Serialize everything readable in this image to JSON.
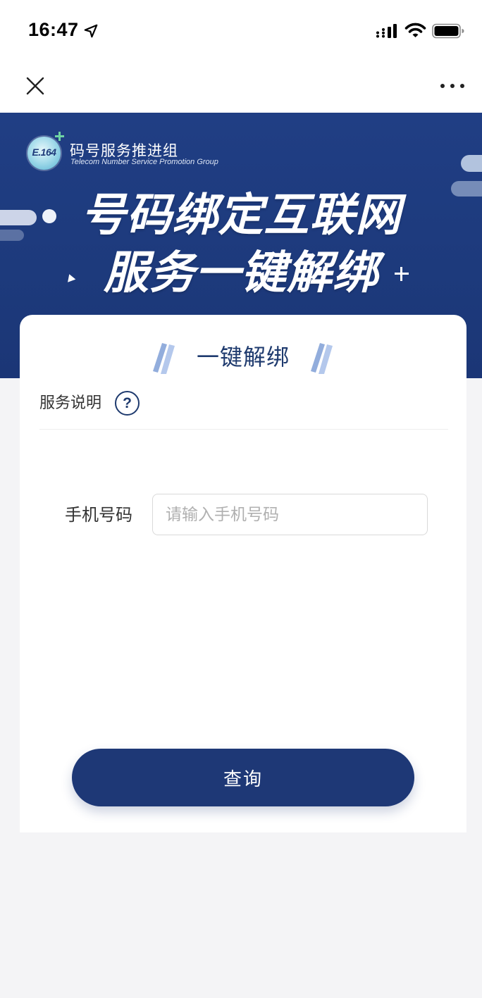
{
  "status_bar": {
    "time": "16:47",
    "icons": [
      "location-arrow-icon",
      "signal-icon",
      "wifi-icon",
      "battery-icon"
    ]
  },
  "nav_bar": {
    "icons": [
      "close-icon",
      "more-icon"
    ]
  },
  "banner": {
    "logo_text": "E.164",
    "org_name": "码号服务推进组",
    "org_name_en": "Telecom Number Service Promotion Group",
    "headline": {
      "line1": "号码绑定互联网",
      "line2": "服务一键解绑"
    }
  },
  "card": {
    "title": "一键解绑",
    "service_note": {
      "label": "服务说明",
      "help_glyph": "?"
    },
    "phone": {
      "label": "手机号码",
      "value": "",
      "placeholder": "请输入手机号码"
    },
    "submit_label": "查询"
  },
  "colors": {
    "brand_navy": "#1e3a7a",
    "button_navy": "#1e3876",
    "title_text": "#1e3a6e",
    "page_background": "#f4f4f6",
    "card_background": "#ffffff",
    "placeholder_text": "#b0b0b0"
  }
}
